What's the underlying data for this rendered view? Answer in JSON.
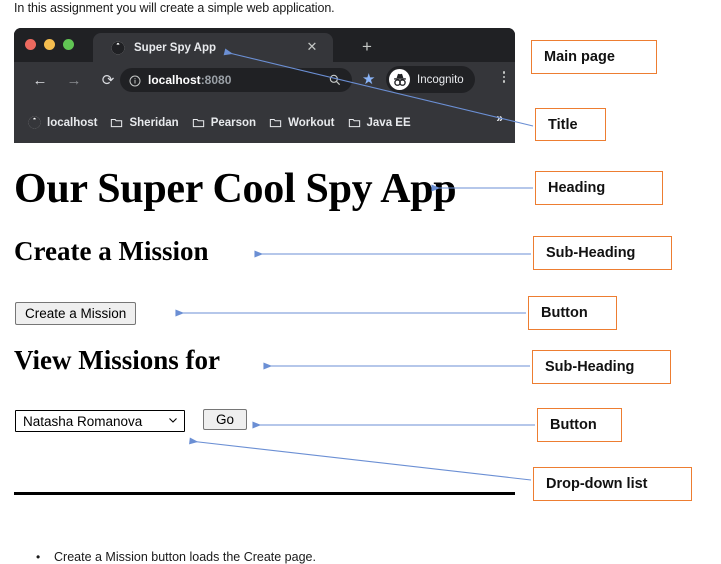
{
  "document": {
    "intro_text": "In this assignment you will create a simple web application.",
    "bullet_item": "Create a Mission button loads the Create page.",
    "bullet_marker": "•"
  },
  "browser": {
    "tab": {
      "title": "Super Spy App",
      "favicon": "globe-icon",
      "close_label": "✕"
    },
    "new_tab_label": "+",
    "toolbar": {
      "back_label": "←",
      "forward_label": "→",
      "reload_label": "⟳",
      "info_icon": "info-circle-icon",
      "url_host": "localhost",
      "url_port": ":8080",
      "zoom_icon": "magnifier-icon",
      "bookmark_star": "★",
      "incognito_label": "Incognito",
      "menu_icon": "kebab-menu-icon"
    },
    "bookmarks": [
      {
        "label": "localhost",
        "icon": "globe-icon"
      },
      {
        "label": "Sheridan",
        "icon": "folder-icon"
      },
      {
        "label": "Pearson",
        "icon": "folder-icon"
      },
      {
        "label": "Workout",
        "icon": "folder-icon"
      },
      {
        "label": "Java EE",
        "icon": "folder-icon"
      }
    ],
    "bookmarks_overflow": "»"
  },
  "page": {
    "heading": "Our Super Cool Spy App",
    "subheading_create": "Create a Mission",
    "create_button": "Create a Mission",
    "subheading_view": "View Missions for",
    "dropdown_selected": "Natasha Romanova",
    "dropdown_chevron": "⌄",
    "go_button": "Go"
  },
  "annotations": {
    "main_page": "Main page",
    "title": "Title",
    "heading": "Heading",
    "sub_heading_1": "Sub-Heading",
    "button_1": "Button",
    "sub_heading_2": "Sub-Heading",
    "button_2": "Button",
    "drop_down": "Drop-down list"
  },
  "colors": {
    "annotation_border": "#ED7D31",
    "arrow": "#6b8fd4",
    "browser_tabstrip": "#202124",
    "browser_toolbar": "#35363a",
    "accent_blue": "#8ab4f8"
  }
}
